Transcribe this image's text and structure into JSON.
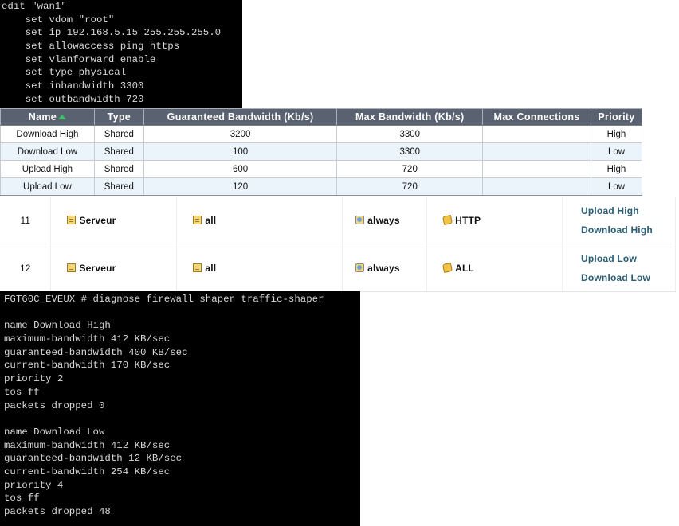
{
  "terminal_config": {
    "lines": [
      "edit \"wan1\"",
      "    set vdom \"root\"",
      "    set ip 192.168.5.15 255.255.255.0",
      "    set allowaccess ping https",
      "    set vlanforward enable",
      "    set type physical",
      "    set inbandwidth 3300",
      "    set outbandwidth 720"
    ]
  },
  "shaper_table": {
    "headers": [
      "Name",
      "Type",
      "Guaranteed Bandwidth (Kb/s)",
      "Max Bandwidth (Kb/s)",
      "Max Connections",
      "Priority"
    ],
    "rows": [
      {
        "name": "Download High",
        "type": "Shared",
        "guaranteed": "3200",
        "max": "3300",
        "max_connections": "",
        "priority": "High"
      },
      {
        "name": "Download Low",
        "type": "Shared",
        "guaranteed": "100",
        "max": "3300",
        "max_connections": "",
        "priority": "Low"
      },
      {
        "name": "Upload High",
        "type": "Shared",
        "guaranteed": "600",
        "max": "720",
        "max_connections": "",
        "priority": "High"
      },
      {
        "name": "Upload Low",
        "type": "Shared",
        "guaranteed": "120",
        "max": "720",
        "max_connections": "",
        "priority": "Low"
      }
    ],
    "colors": {
      "header_bg": "#5a6170",
      "alt_row_bg": "#ebf3fb",
      "sort_arrow": "#39c46a"
    }
  },
  "policies": [
    {
      "id": "11",
      "source": "Serveur",
      "destination": "all",
      "schedule": "always",
      "service": "HTTP",
      "forward_shaper": "Upload High",
      "reverse_shaper": "Download High"
    },
    {
      "id": "12",
      "source": "Serveur",
      "destination": "all",
      "schedule": "always",
      "service": "ALL",
      "forward_shaper": "Upload Low",
      "reverse_shaper": "Download Low"
    }
  ],
  "terminal_diag": {
    "lines": [
      "FGT60C_EVEUX # diagnose firewall shaper traffic-shaper",
      "",
      "name Download High",
      "maximum-bandwidth 412 KB/sec",
      "guaranteed-bandwidth 400 KB/sec",
      "current-bandwidth 170 KB/sec",
      "priority 2",
      "tos ff",
      "packets dropped 0",
      "",
      "name Download Low",
      "maximum-bandwidth 412 KB/sec",
      "guaranteed-bandwidth 12 KB/sec",
      "current-bandwidth 254 KB/sec",
      "priority 4",
      "tos ff",
      "packets dropped 48"
    ]
  },
  "icons": {
    "address": "address-icon",
    "schedule": "schedule-icon",
    "service": "service-icon",
    "sort": "sort-ascending-icon"
  }
}
